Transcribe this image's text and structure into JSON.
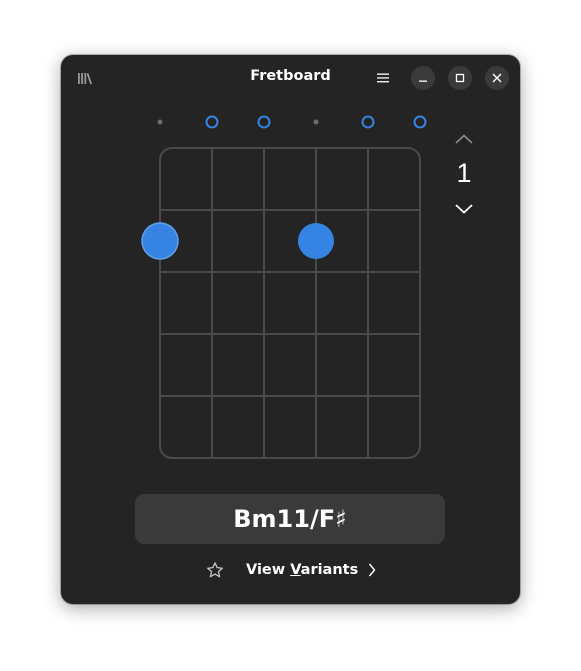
{
  "window": {
    "title": "Fretboard"
  },
  "headerbar": {
    "library_icon": "library-icon",
    "menu_icon": "hamburger-menu-icon",
    "minimize_icon": "minimize-icon",
    "maximize_icon": "maximize-icon",
    "close_icon": "close-icon"
  },
  "fretboard": {
    "strings": 6,
    "frets_shown": 5,
    "string_markers": [
      "muted",
      "open",
      "open",
      "muted",
      "open",
      "open"
    ],
    "notes": [
      {
        "string": 1,
        "fret": 2
      },
      {
        "string": 4,
        "fret": 2
      }
    ],
    "colors": {
      "accent": "#3584e4",
      "grid": "#4a4a4a",
      "muted": "#6e6e6e"
    }
  },
  "fret_navigation": {
    "up_icon": "chevron-up-icon",
    "down_icon": "chevron-down-icon",
    "fret_number": "1"
  },
  "chord": {
    "name": "Bm11/F♯"
  },
  "footer": {
    "star_icon": "star-outline-icon",
    "variants_label_pre": "View ",
    "variants_label_mnemonic": "V",
    "variants_label_post": "ariants",
    "variants_icon": "chevron-right-icon"
  }
}
